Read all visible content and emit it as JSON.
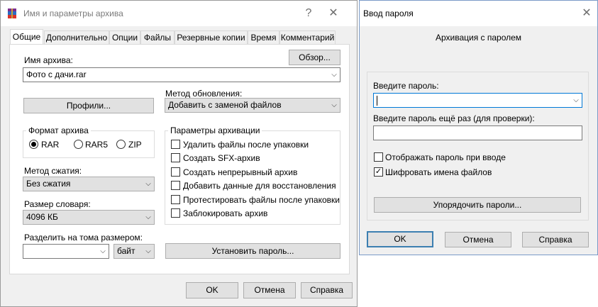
{
  "archive_window": {
    "title": "Имя и параметры архива",
    "help_glyph": "?",
    "close_glyph": "✕",
    "tabs": [
      {
        "label": "Общие"
      },
      {
        "label": "Дополнительно"
      },
      {
        "label": "Опции"
      },
      {
        "label": "Файлы"
      },
      {
        "label": "Резервные копии"
      },
      {
        "label": "Время"
      },
      {
        "label": "Комментарий"
      }
    ],
    "archive_name_label": "Имя архива:",
    "browse_label": "Обзор...",
    "archive_name_value": "Фото с дачи.rar",
    "update_method_label": "Метод обновления:",
    "update_method_value": "Добавить с заменой файлов",
    "profiles_label": "Профили...",
    "format_group_label": "Формат архива",
    "format_options": [
      {
        "label": "RAR",
        "selected": true
      },
      {
        "label": "RAR5",
        "selected": false
      },
      {
        "label": "ZIP",
        "selected": false
      }
    ],
    "params_group_label": "Параметры архивации",
    "params_options": [
      {
        "label": "Удалить файлы после упаковки",
        "checked": false
      },
      {
        "label": "Создать SFX-архив",
        "checked": false
      },
      {
        "label": "Создать непрерывный архив",
        "checked": false
      },
      {
        "label": "Добавить данные для восстановления",
        "checked": false
      },
      {
        "label": "Протестировать файлы после упаковки",
        "checked": false
      },
      {
        "label": "Заблокировать архив",
        "checked": false
      }
    ],
    "compression_label": "Метод сжатия:",
    "compression_value": "Без сжатия",
    "dict_size_label": "Размер словаря:",
    "dict_size_value": "4096 КБ",
    "split_label": "Разделить на тома размером:",
    "split_value": "",
    "split_unit": "байт",
    "set_password_label": "Установить пароль...",
    "ok_label": "OK",
    "cancel_label": "Отмена",
    "help_label": "Справка"
  },
  "password_window": {
    "title": "Ввод пароля",
    "close_glyph": "✕",
    "subtitle": "Архивация с паролем",
    "enter_password_label": "Введите пароль:",
    "password_value": "",
    "reenter_label": "Введите пароль ещё раз (для проверки):",
    "reenter_value": "",
    "show_password_label": "Отображать пароль при вводе",
    "show_password_checked": false,
    "encrypt_names_label": "Шифровать имена файлов",
    "encrypt_names_checked": true,
    "organize_label": "Упорядочить пароли...",
    "ok_label": "OK",
    "cancel_label": "Отмена",
    "help_label": "Справка"
  },
  "colors": {
    "accent": "#0078d7",
    "default_button_border": "#3c7fb1",
    "winrar_icon": [
      "#7b2c8f",
      "#2b6cc4",
      "#d9342b"
    ]
  },
  "icons": {
    "check": "✓",
    "chevron_down": "⌵"
  }
}
